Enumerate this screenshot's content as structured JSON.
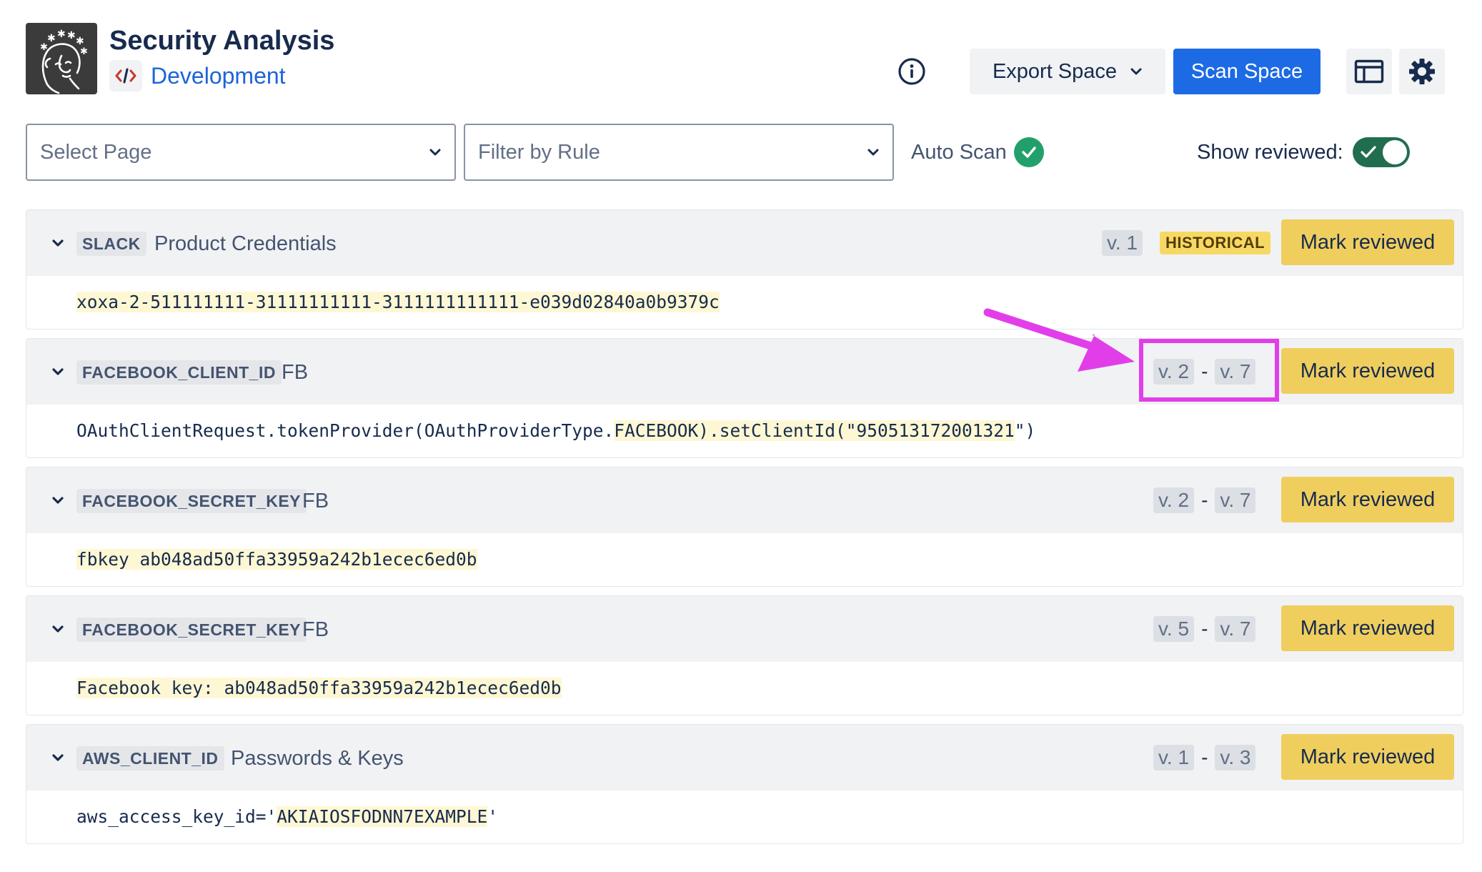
{
  "header": {
    "title": "Security Analysis",
    "space_name": "Development",
    "export_label": "Export Space",
    "scan_label": "Scan Space"
  },
  "filters": {
    "select_page_placeholder": "Select Page",
    "filter_rule_placeholder": "Filter by Rule",
    "auto_scan_label": "Auto Scan",
    "show_reviewed_label": "Show reviewed:",
    "show_reviewed_on": true
  },
  "findings": [
    {
      "rule": "SLACK",
      "name": "Product Credentials",
      "versions": [
        "v. 1"
      ],
      "badge": "HISTORICAL",
      "action": "Mark reviewed",
      "snippet_pre": "",
      "snippet_hl": "xoxa-2-511111111-31111111111-3111111111111-e039d02840a0b9379c",
      "snippet_post": ""
    },
    {
      "rule": "FACEBOOK_CLIENT_ID",
      "name": "FB",
      "versions": [
        "v. 2",
        "v. 7"
      ],
      "action": "Mark reviewed",
      "snippet_pre": "OAuthClientRequest.tokenProvider(OAuthProviderType.",
      "snippet_hl": "FACEBOOK).setClientId(\"950513172001321",
      "snippet_post": "\")"
    },
    {
      "rule": "FACEBOOK_SECRET_KEY",
      "name": "FB",
      "versions": [
        "v. 2",
        "v. 7"
      ],
      "action": "Mark reviewed",
      "snippet_pre": "",
      "snippet_hl": "fbkey ab048ad50ffa33959a242b1ecec6ed0b",
      "snippet_post": ""
    },
    {
      "rule": "FACEBOOK_SECRET_KEY",
      "name": "FB",
      "versions": [
        "v. 5",
        "v. 7"
      ],
      "action": "Mark reviewed",
      "snippet_pre": "",
      "snippet_hl": "Facebook key: ab048ad50ffa33959a242b1ecec6ed0b",
      "snippet_post": ""
    },
    {
      "rule": "AWS_CLIENT_ID",
      "name": "Passwords & Keys",
      "versions": [
        "v. 1",
        "v. 3"
      ],
      "action": "Mark reviewed",
      "snippet_pre": "aws_access_key_id='",
      "snippet_hl": "AKIAIOSFODNN7EXAMPLE",
      "snippet_post": "'"
    }
  ],
  "icons": {
    "logo": "woman-face-logo-icon",
    "space": "code-brackets-icon",
    "info": "info-circle-icon",
    "export_caret": "chevron-down-icon",
    "layout": "sidebar-layout-icon",
    "settings": "gear-icon",
    "auto_scan_status": "check-circle-icon",
    "row_toggle": "chevron-down-icon"
  },
  "colors": {
    "primary": "#1d6ae5",
    "review_button": "#f0ce5e",
    "historical_badge": "#f8d865",
    "highlight": "#fef7d4",
    "toggle_on": "#216e4e",
    "annotation": "#e13ee9",
    "success": "#22a06b"
  },
  "annotation": {
    "highlighted_versions": [
      "v. 2",
      "v. 7"
    ]
  }
}
